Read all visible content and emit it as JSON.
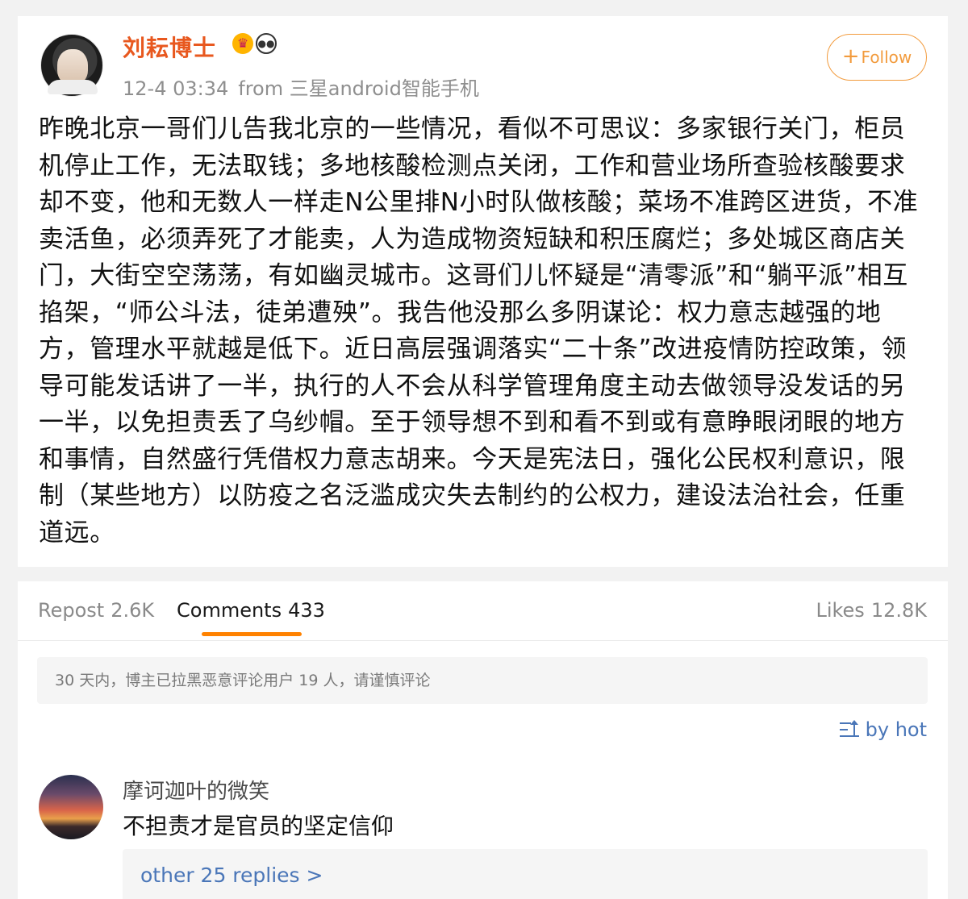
{
  "post": {
    "author": "刘耘博士",
    "badges": [
      "crown-badge",
      "panda-badge"
    ],
    "time": "12-4 03:34",
    "source": "from 三星android智能手机",
    "follow_label": "Follow",
    "follow_plus": "+",
    "text": "昨晚北京一哥们儿告我北京的一些情况，看似不可思议：多家银行关门，柜员机停止工作，无法取钱；多地核酸检测点关闭，工作和营业场所查验核酸要求却不变，他和无数人一样走N公里排N小时队做核酸；菜场不准跨区进货，不准卖活鱼，必须弄死了才能卖，人为造成物资短缺和积压腐烂；多处城区商店关门，大街空空荡荡，有如幽灵城市。这哥们儿怀疑是“清零派”和“躺平派”相互掐架，“师公斗法，徒弟遭殃”。我告他没那么多阴谋论：权力意志越强的地方，管理水平就越是低下。近日高层强调落实“二十条”改进疫情防控政策，领导可能发话讲了一半，执行的人不会从科学管理角度主动去做领导没发话的另一半，以免担责丢了乌纱帽。至于领导想不到和看不到或有意睁眼闭眼的地方和事情，自然盛行凭借权力意志胡来。今天是宪法日，强化公民权利意识，限制（某些地方）以防疫之名泛滥成灾失去制约的公权力，建设法治社会，任重道远。"
  },
  "tabs": {
    "repost_label": "Repost",
    "repost_count": "2.6K",
    "comments_label": "Comments",
    "comments_count": "433",
    "likes_label": "Likes",
    "likes_count": "12.8K"
  },
  "notice": "30 天内，博主已拉黑恶意评论用户 19 人，请谨慎评论",
  "sort_label": "by hot",
  "comment": {
    "author": "摩诃迦叶的微笑",
    "text": "不担责才是官员的坚定信仰",
    "replies_label": "other 25 replies >"
  },
  "colors": {
    "accent": "#ff8200",
    "username": "#e8581f",
    "link": "#4a76b8"
  }
}
